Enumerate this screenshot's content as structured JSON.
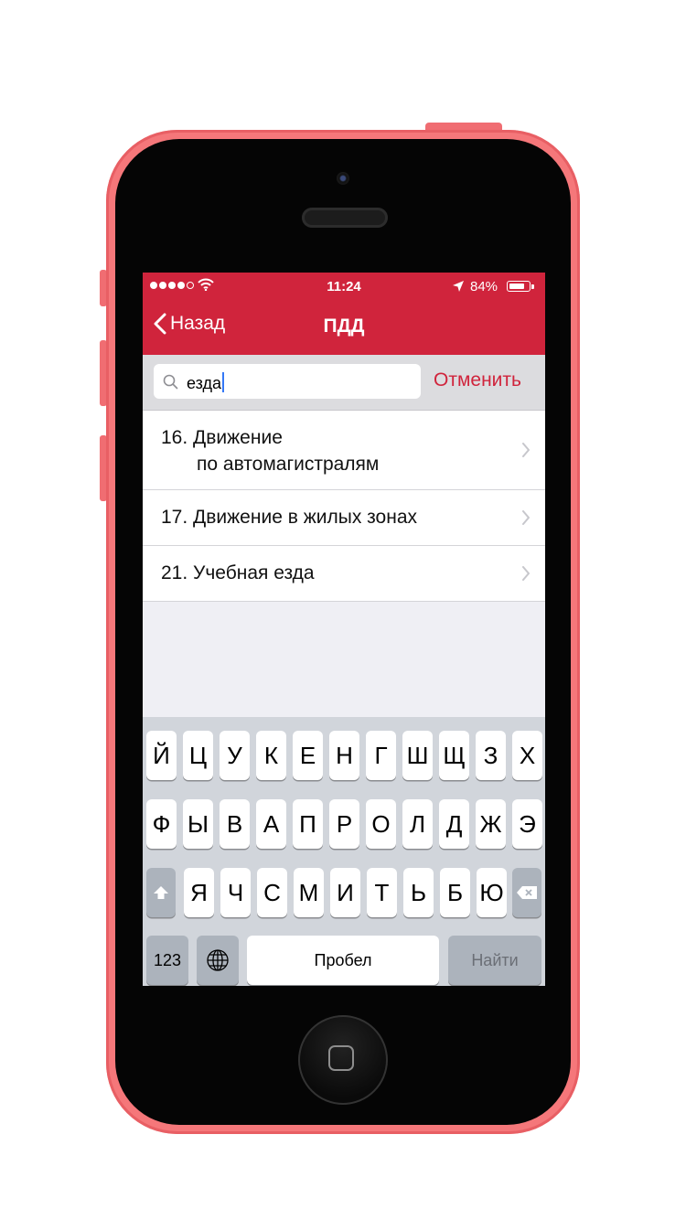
{
  "status_bar": {
    "time": "11:24",
    "battery": "84%",
    "battery_level": 0.84,
    "signal_dots_filled": 4,
    "signal_dots_total": 5
  },
  "nav": {
    "back_label": "Назад",
    "title": "ПДД"
  },
  "search": {
    "value": "езда",
    "cancel_label": "Отменить"
  },
  "results": [
    {
      "line1": "16. Движение",
      "line2": "по автомагистралям"
    },
    {
      "line1": "17. Движение в жилых зонах"
    },
    {
      "line1": "21. Учебная езда"
    }
  ],
  "keyboard": {
    "row1": [
      "Й",
      "Ц",
      "У",
      "К",
      "Е",
      "Н",
      "Г",
      "Ш",
      "Щ",
      "З",
      "Х"
    ],
    "row2": [
      "Ф",
      "Ы",
      "В",
      "А",
      "П",
      "Р",
      "О",
      "Л",
      "Д",
      "Ж",
      "Э"
    ],
    "row3": [
      "Я",
      "Ч",
      "С",
      "М",
      "И",
      "Т",
      "Ь",
      "Б",
      "Ю"
    ],
    "numbers_label": "123",
    "space_label": "Пробел",
    "search_label": "Найти"
  },
  "colors": {
    "accent": "#d0243c",
    "phone_shell": "#f5777a"
  }
}
